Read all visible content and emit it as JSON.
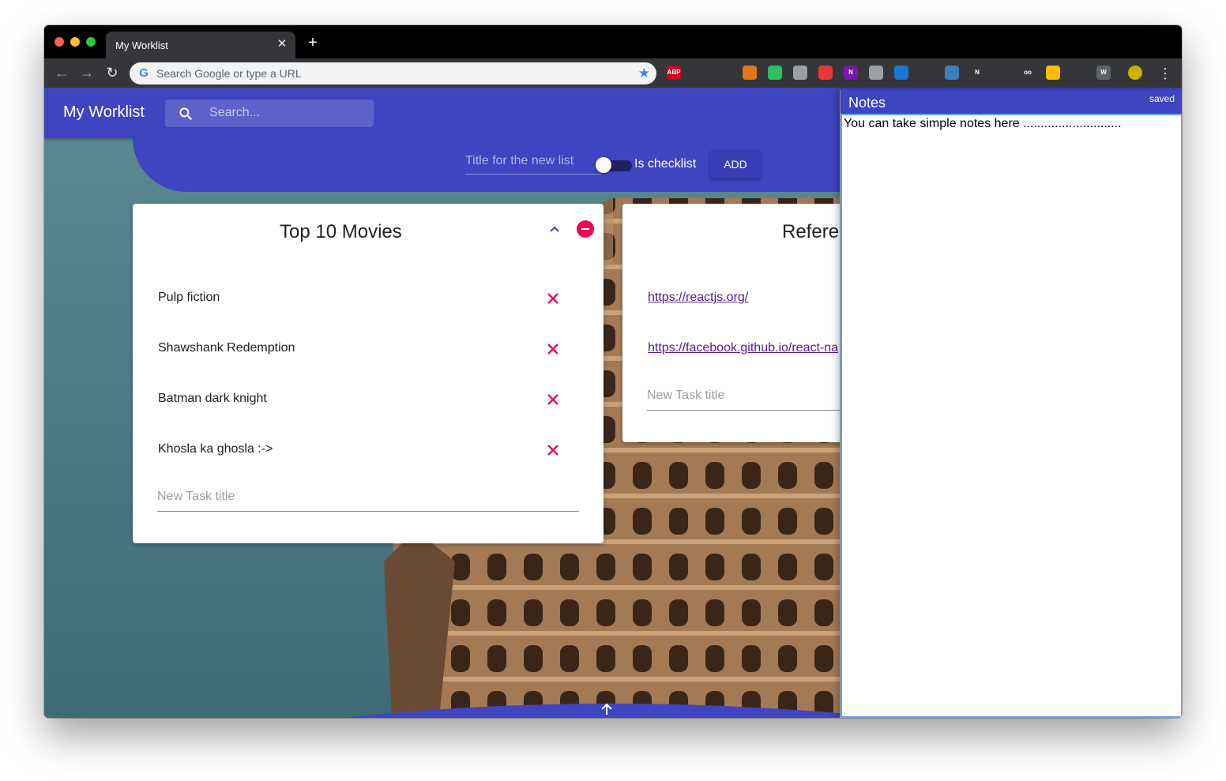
{
  "browser": {
    "tab_title": "My Worklist",
    "tab_close": "✕",
    "new_tab": "+",
    "omnibox_placeholder": "Search Google or type a URL",
    "extensions": [
      {
        "name": "adblock-icon",
        "label": "ABP",
        "color": "#d0021b"
      },
      {
        "name": "pocket-icon",
        "label": "",
        "color": "#35363a"
      },
      {
        "name": "shark-icon",
        "label": "",
        "color": "#35363a"
      },
      {
        "name": "metamask-icon",
        "label": "",
        "color": "#e2761b"
      },
      {
        "name": "evernote-icon",
        "label": "",
        "color": "#2dbe60"
      },
      {
        "name": "circle-icon",
        "label": "",
        "color": "#9aa0a6"
      },
      {
        "name": "grammarly-icon",
        "label": "",
        "color": "#e53935"
      },
      {
        "name": "onenote-icon",
        "label": "N",
        "color": "#7719aa"
      },
      {
        "name": "target-icon",
        "label": "",
        "color": "#9aa0a6"
      },
      {
        "name": "shield-icon",
        "label": "",
        "color": "#1976d2"
      },
      {
        "name": "react-devtools-icon",
        "label": "",
        "color": "#35363a"
      },
      {
        "name": "download-icon",
        "label": "",
        "color": "#3f7fbf"
      },
      {
        "name": "notion-icon",
        "label": "N",
        "color": "#35363a"
      },
      {
        "name": "pen-icon",
        "label": "",
        "color": "#35363a"
      },
      {
        "name": "glasses-icon",
        "label": "oo",
        "color": "#35363a"
      },
      {
        "name": "chrome-icon",
        "label": "",
        "color": "#fbbc04"
      },
      {
        "name": "mascot-icon",
        "label": "",
        "color": "#35363a"
      },
      {
        "name": "w-icon",
        "label": "W",
        "color": "#5f6368"
      },
      {
        "name": "profile-avatar-icon",
        "label": "",
        "color": "#c8b400"
      }
    ]
  },
  "app": {
    "title": "My Worklist",
    "search_placeholder": "Search...",
    "new_list": {
      "title_placeholder": "Title for the new list",
      "checklist_label": "Is checklist",
      "checklist_on": false,
      "add_label": "ADD"
    }
  },
  "lists": [
    {
      "title": "Top 10 Movies",
      "tasks": [
        "Pulp fiction",
        "Shawshank Redemption",
        "Batman dark knight",
        "Khosla ka ghosla :->"
      ],
      "new_task_placeholder": "New Task title"
    },
    {
      "title": "Refere",
      "links": [
        "https://reactjs.org/",
        "https://facebook.github.io/react-na"
      ],
      "new_task_placeholder": "New Task title"
    }
  ],
  "notes": {
    "title": "Notes",
    "status": "saved",
    "content": "You can take simple notes here ............................"
  },
  "colors": {
    "primary": "#3f44c0",
    "delete_accent": "#ef0a4f",
    "link": "#551a8b"
  }
}
